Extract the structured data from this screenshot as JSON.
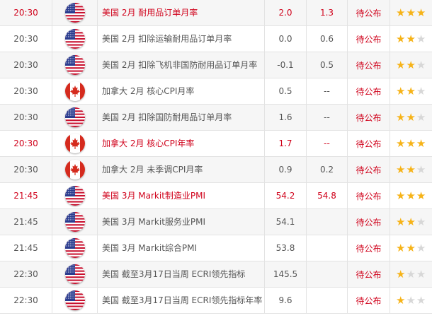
{
  "calendar": {
    "rows": [
      {
        "time": "20:30",
        "country": "us",
        "flag_icon": "us-flag-icon",
        "event": "美国 2月 耐用品订单月率",
        "v1": "2.0",
        "v2": "1.3",
        "status": "待公布",
        "importance": 3,
        "highlight": true
      },
      {
        "time": "20:30",
        "country": "us",
        "flag_icon": "us-flag-icon",
        "event": "美国 2月 扣除运输耐用品订单月率",
        "v1": "0.0",
        "v2": "0.6",
        "status": "待公布",
        "importance": 2,
        "highlight": false
      },
      {
        "time": "20:30",
        "country": "us",
        "flag_icon": "us-flag-icon",
        "event": "美国 2月 扣除飞机非国防耐用品订单月率",
        "v1": "-0.1",
        "v2": "0.5",
        "status": "待公布",
        "importance": 2,
        "highlight": false
      },
      {
        "time": "20:30",
        "country": "ca",
        "flag_icon": "canada-flag-icon",
        "event": "加拿大 2月 核心CPI月率",
        "v1": "0.5",
        "v2": "--",
        "status": "待公布",
        "importance": 2,
        "highlight": false
      },
      {
        "time": "20:30",
        "country": "us",
        "flag_icon": "us-flag-icon",
        "event": "美国 2月 扣除国防耐用品订单月率",
        "v1": "1.6",
        "v2": "--",
        "status": "待公布",
        "importance": 2,
        "highlight": false
      },
      {
        "time": "20:30",
        "country": "ca",
        "flag_icon": "canada-flag-icon",
        "event": "加拿大 2月 核心CPI年率",
        "v1": "1.7",
        "v2": "--",
        "status": "待公布",
        "importance": 3,
        "highlight": true
      },
      {
        "time": "20:30",
        "country": "ca",
        "flag_icon": "canada-flag-icon",
        "event": "加拿大 2月 未季调CPI月率",
        "v1": "0.9",
        "v2": "0.2",
        "status": "待公布",
        "importance": 2,
        "highlight": false
      },
      {
        "time": "21:45",
        "country": "us",
        "flag_icon": "us-flag-icon",
        "event": "美国 3月 Markit制造业PMI",
        "v1": "54.2",
        "v2": "54.8",
        "status": "待公布",
        "importance": 3,
        "highlight": true
      },
      {
        "time": "21:45",
        "country": "us",
        "flag_icon": "us-flag-icon",
        "event": "美国 3月 Markit服务业PMI",
        "v1": "54.1",
        "v2": "",
        "status": "待公布",
        "importance": 2,
        "highlight": false
      },
      {
        "time": "21:45",
        "country": "us",
        "flag_icon": "us-flag-icon",
        "event": "美国 3月 Markit综合PMI",
        "v1": "53.8",
        "v2": "",
        "status": "待公布",
        "importance": 2,
        "highlight": false
      },
      {
        "time": "22:30",
        "country": "us",
        "flag_icon": "us-flag-icon",
        "event": "美国 截至3月17日当周 ECRI领先指标",
        "v1": "145.5",
        "v2": "",
        "status": "待公布",
        "importance": 1,
        "highlight": false
      },
      {
        "time": "22:30",
        "country": "us",
        "flag_icon": "us-flag-icon",
        "event": "美国 截至3月17日当周 ECRI领先指标年率",
        "v1": "9.6",
        "v2": "",
        "status": "待公布",
        "importance": 1,
        "highlight": false
      }
    ],
    "max_stars": 3,
    "colors": {
      "highlight": "#d0021b",
      "star_on": "#f6b318",
      "star_off": "#d7d7d7",
      "row_alt": "#f6f6f6",
      "border": "#e3e3e3"
    }
  }
}
